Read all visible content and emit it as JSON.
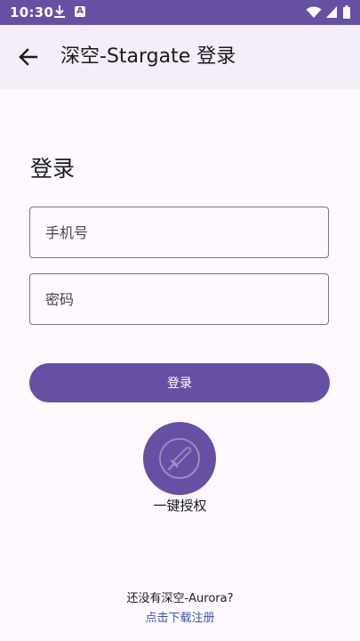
{
  "status_bar": {
    "time": "10:30",
    "notification_letter": "A"
  },
  "app_bar": {
    "title": "深空-Stargate 登录"
  },
  "form": {
    "heading": "登录",
    "phone_placeholder": "手机号",
    "password_placeholder": "密码",
    "login_button": "登录",
    "one_click_auth_label": "一键授权"
  },
  "footer": {
    "no_account_text": "还没有深空-Aurora?",
    "register_link": "点击下载注册"
  },
  "colors": {
    "primary": "#6750a4",
    "background": "#fdf9fe",
    "app_bar": "#f3eef7",
    "link": "#3f51b5"
  }
}
